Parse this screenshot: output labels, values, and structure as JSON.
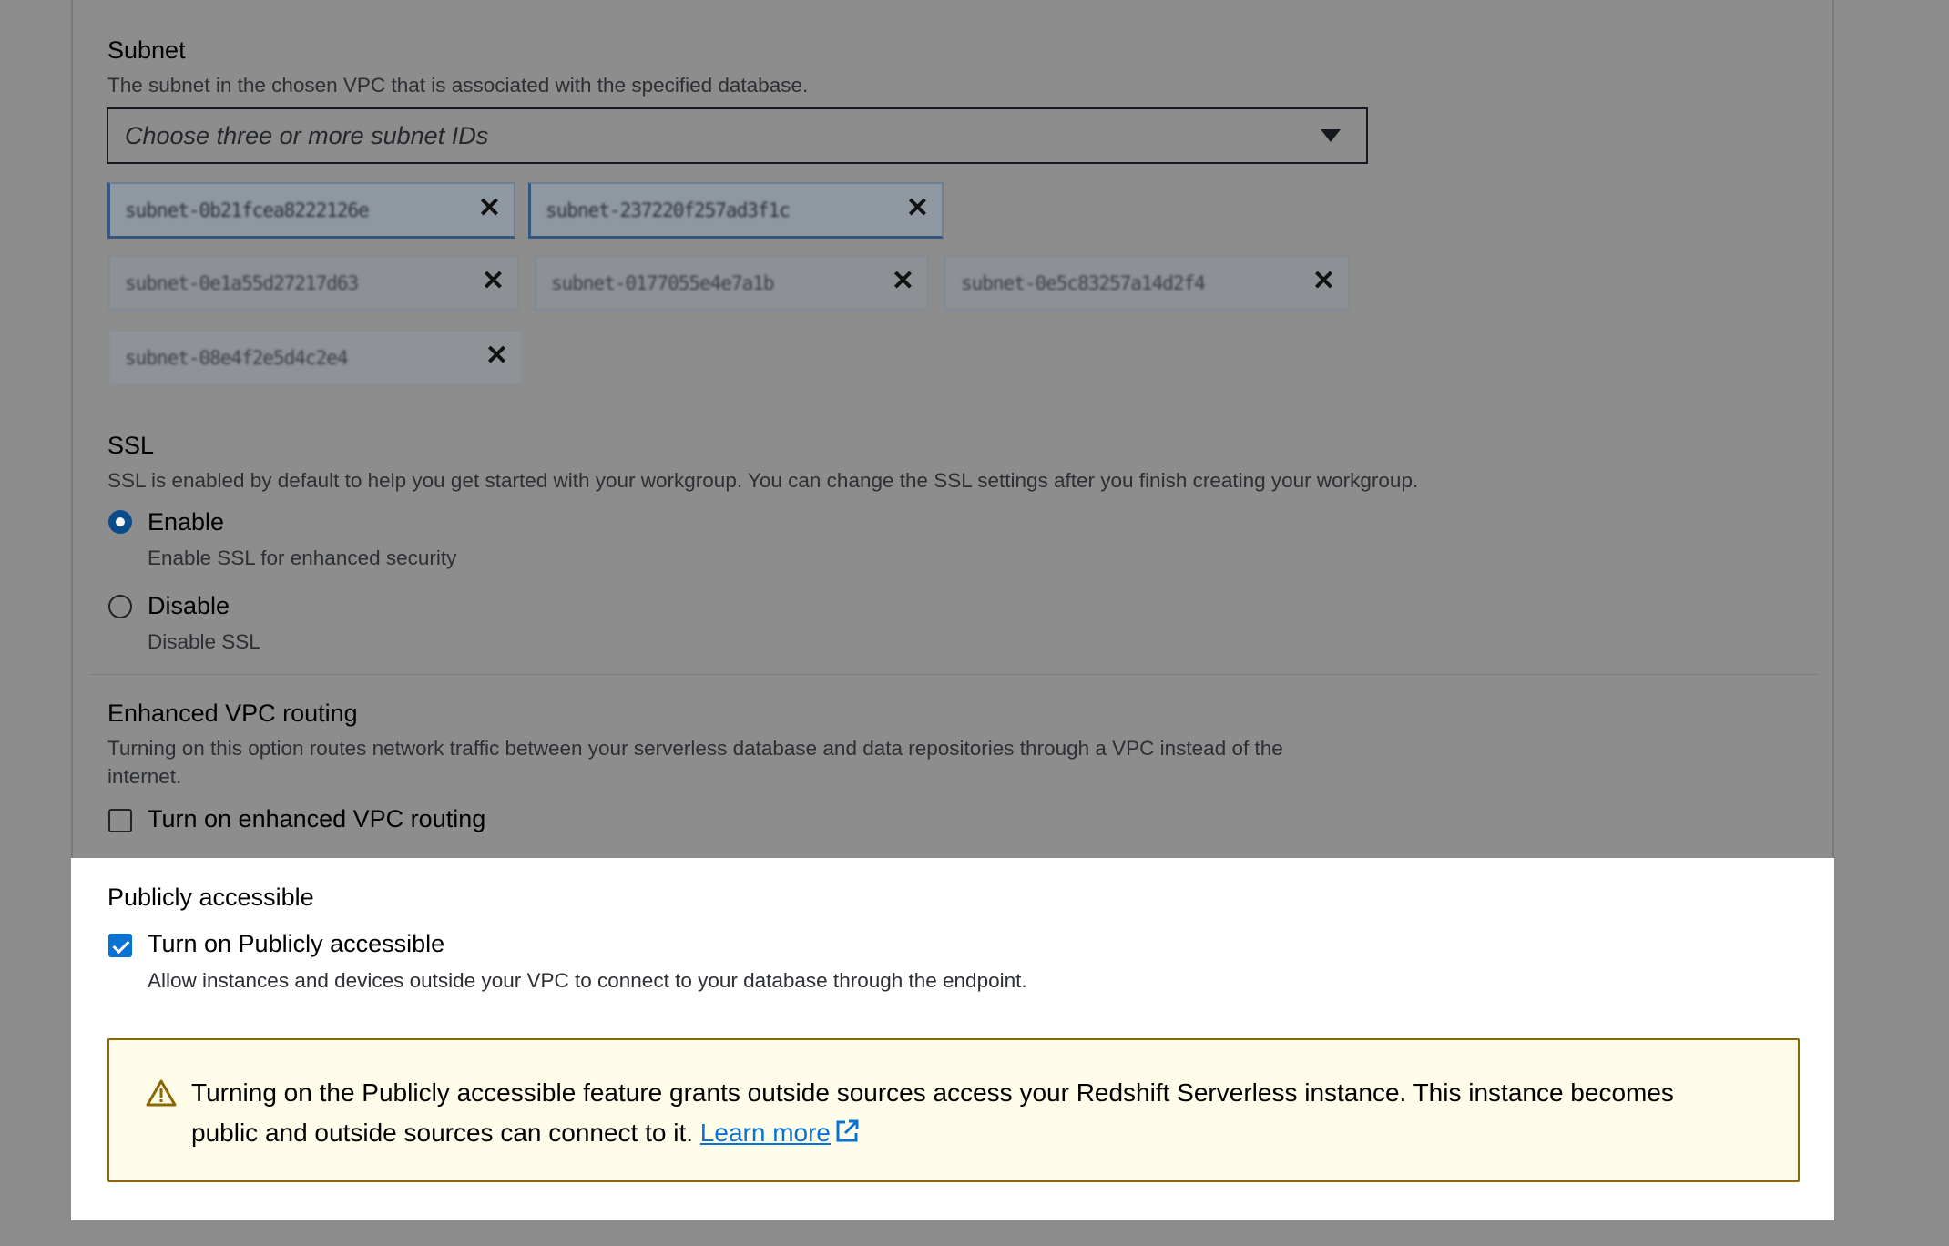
{
  "subnet": {
    "title": "Subnet",
    "description": "The subnet in the chosen VPC that is associated with the specified database.",
    "placeholder": "Choose three or more subnet IDs",
    "tokens": [
      "subnet-0b21fcea8222126e",
      "subnet-237220f257ad3f1c",
      "subnet-0e1a55d27217d63",
      "subnet-0177055e4e7a1b",
      "subnet-0e5c83257a14d2f4",
      "subnet-08e4f2e5d4c2e4"
    ]
  },
  "ssl": {
    "title": "SSL",
    "description": "SSL is enabled by default to help you get started with your workgroup. You can change the SSL settings after you finish creating your workgroup.",
    "enable_label": "Enable",
    "enable_desc": "Enable SSL for enhanced security",
    "disable_label": "Disable",
    "disable_desc": "Disable SSL",
    "selected": "Enable"
  },
  "vpc_routing": {
    "title": "Enhanced VPC routing",
    "description_line1": "Turning on this option routes network traffic between your serverless database and data repositories through a VPC instead of the",
    "description_line2": "internet.",
    "checkbox_label": "Turn on enhanced VPC routing",
    "checked": false
  },
  "public": {
    "title": "Publicly accessible",
    "checkbox_label": "Turn on Publicly accessible",
    "checkbox_desc": "Allow instances and devices outside your VPC to connect to your database through the endpoint.",
    "checked": true
  },
  "alert": {
    "line1": "Turning on the Publicly accessible feature grants outside sources access your Redshift Serverless instance. This instance becomes",
    "line2": "public and outside sources can connect to it.",
    "link": "Learn more",
    "icon": "warning-icon",
    "colors": {
      "background": "#fffce9",
      "border": "#8d6605",
      "link": "#0972d3"
    }
  }
}
